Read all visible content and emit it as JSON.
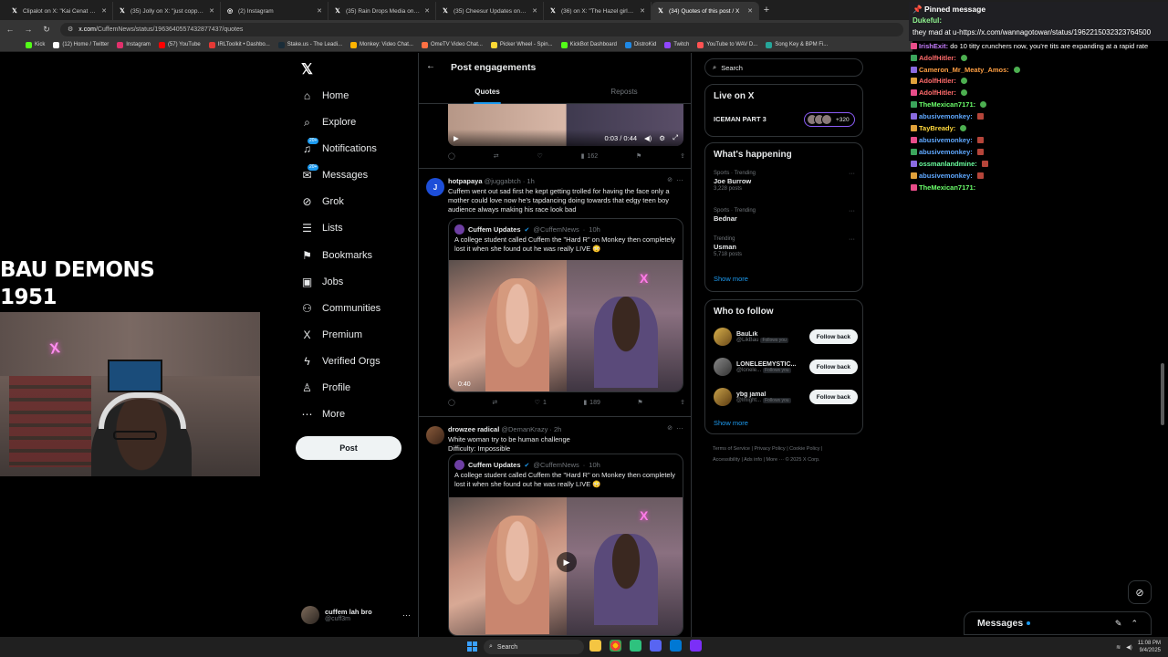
{
  "browser": {
    "tabs": [
      {
        "title": "Clipalot on X: \"Kai Cenat w...",
        "icon": "x-logo-icon",
        "active": false
      },
      {
        "title": "(35) Jolly on X: \"just copped a n...",
        "icon": "x-logo-icon",
        "active": false
      },
      {
        "title": "(2) Instagram",
        "icon": "instagram-icon",
        "active": false
      },
      {
        "title": "(35) Rain Drops Media on X: \"i...",
        "icon": "x-logo-icon",
        "active": false
      },
      {
        "title": "(35) Cheesur Updates on X: \"Ch...",
        "icon": "x-logo-icon",
        "active": false
      },
      {
        "title": "(36) on X: \"The Hazel girls bf p...",
        "icon": "x-logo-icon",
        "active": false
      },
      {
        "title": "(34) Quotes of this post / X",
        "icon": "x-logo-icon",
        "active": true
      }
    ],
    "url_domain": "x.com",
    "url_path": "/CuffemNews/status/1963640557432877437/quotes",
    "bookmarks": [
      {
        "label": "Kick",
        "color": "#53fc18"
      },
      {
        "label": "(12) Home / Twitter",
        "color": "#ffffff"
      },
      {
        "label": "Instagram",
        "color": "#e1306c"
      },
      {
        "label": "(57) YouTube",
        "color": "#ff0000"
      },
      {
        "label": "IRLToolkit • Dashbo...",
        "color": "#e53935"
      },
      {
        "label": "Stake.us - The Leadi...",
        "color": "#1a2c38"
      },
      {
        "label": "Monkey: Video Chat...",
        "color": "#ffb300"
      },
      {
        "label": "OmeTV Video Chat...",
        "color": "#ff7043"
      },
      {
        "label": "Picker Wheel - Spin...",
        "color": "#fdd835"
      },
      {
        "label": "KickBot Dashboard",
        "color": "#53fc18"
      },
      {
        "label": "DistroKid",
        "color": "#1e88e5"
      },
      {
        "label": "Twitch",
        "color": "#9146ff"
      },
      {
        "label": "YouTube to WAV D...",
        "color": "#ff5252"
      },
      {
        "label": "Song Key & BPM Fi...",
        "color": "#26a69a"
      }
    ]
  },
  "overlay": {
    "line1": "BAU DEMONS",
    "line2": "1951",
    "neon_sign": "X"
  },
  "x_nav": {
    "items": [
      {
        "label": "Home",
        "icon": "home-icon",
        "glyph": "⌂"
      },
      {
        "label": "Explore",
        "icon": "search-icon",
        "glyph": "⌕"
      },
      {
        "label": "Notifications",
        "icon": "bell-icon",
        "glyph": "♫",
        "badge": "20+"
      },
      {
        "label": "Messages",
        "icon": "envelope-icon",
        "glyph": "✉",
        "badge": "20+"
      },
      {
        "label": "Grok",
        "icon": "grok-icon",
        "glyph": "⊘"
      },
      {
        "label": "Lists",
        "icon": "list-icon",
        "glyph": "☰"
      },
      {
        "label": "Bookmarks",
        "icon": "bookmark-icon",
        "glyph": "⚑"
      },
      {
        "label": "Jobs",
        "icon": "briefcase-icon",
        "glyph": "▣"
      },
      {
        "label": "Communities",
        "icon": "people-icon",
        "glyph": "⚇"
      },
      {
        "label": "Premium",
        "icon": "x-logo-icon",
        "glyph": "X"
      },
      {
        "label": "Verified Orgs",
        "icon": "lightning-icon",
        "glyph": "ϟ"
      },
      {
        "label": "Profile",
        "icon": "person-icon",
        "glyph": "♙"
      },
      {
        "label": "More",
        "icon": "more-circle-icon",
        "glyph": "⋯"
      }
    ],
    "post_button": "Post",
    "account": {
      "name": "cuffem lah bro",
      "handle": "@cuff3m"
    }
  },
  "main": {
    "title": "Post engagements",
    "tabs": [
      {
        "label": "Quotes",
        "active": true
      },
      {
        "label": "Reposts",
        "active": false
      }
    ],
    "top_video": {
      "time": "0:03 / 0:44",
      "views": "162"
    },
    "tweet1": {
      "avatar_letter": "J",
      "name": "hotpapaya",
      "handle": "@juggabtch",
      "time": "1h",
      "text": "Cuffem went out sad first he kept getting trolled for having the face only a mother could love now he's tapdancing doing towards that edgy teen boy audience always making his race look bad",
      "quote_name": "Cuffem Updates",
      "quote_handle": "@CuffemNews",
      "quote_time": "10h",
      "quote_text": "A college student called Cuffem the \"Hard R\" on Monkey then completely lost it when she found out he was really LIVE 😳",
      "duration": "0:40",
      "likes": "1",
      "views": "189"
    },
    "tweet2": {
      "name": "drowzee radical",
      "handle": "@DemanKrazy",
      "time": "2h",
      "text_line1": "White woman try to be human challenge",
      "text_line2": "Difficulty: Impossible",
      "quote_name": "Cuffem Updates",
      "quote_handle": "@CuffemNews",
      "quote_time": "10h",
      "quote_text": "A college student called Cuffem the \"Hard R\" on Monkey then completely lost it when she found out he was really LIVE 😳"
    }
  },
  "right": {
    "search_placeholder": "Search",
    "live_heading": "Live on X",
    "live_title": "ICEMAN PART 3",
    "live_count": "+320",
    "happening_heading": "What's happening",
    "trends": [
      {
        "category": "Sports · Trending",
        "name": "Joe Burrow",
        "posts": "3,228 posts"
      },
      {
        "category": "Sports · Trending",
        "name": "Bednar",
        "posts": ""
      },
      {
        "category": "Trending",
        "name": "Usman",
        "posts": "5,718 posts"
      }
    ],
    "show_more": "Show more",
    "wtf_heading": "Who to follow",
    "who_to_follow": [
      {
        "name": "BauLik",
        "handle": "@LikBau",
        "follows_you": "Follows you",
        "button": "Follow back"
      },
      {
        "name": "LONELEEMYSTIC...",
        "handle": "@lonele...",
        "follows_you": "Follows you",
        "button": "Follow back"
      },
      {
        "name": "ybg jamal",
        "handle": "@lmight...",
        "follows_you": "Follows you",
        "button": "Follow back"
      }
    ],
    "footer_line1": "Terms of Service  |  Privacy Policy  |  Cookie Policy  |",
    "footer_line2": "Accessibility  |  Ads info  |  More ···  © 2025 X Corp."
  },
  "chat": {
    "pinned_header": "Pinned message",
    "pinned_user": "Dukeful:",
    "pinned_text": "they mad at u-https://x.com/wannagotowar/status/1962215032323764500",
    "lines": [
      {
        "user": "IrishExit:",
        "color": "#c77dff",
        "msg": "do 10 titty crunchers now, you're tits are expanding at a rapid rate",
        "emote": ""
      },
      {
        "user": "AdolfHitler:",
        "color": "#ff6b6b",
        "msg": "",
        "emote": "green"
      },
      {
        "user": "Cameron_Mr_Meaty_Amos:",
        "color": "#ff9f43",
        "msg": "",
        "emote": "green"
      },
      {
        "user": "AdolfHitler:",
        "color": "#ff6b6b",
        "msg": "",
        "emote": "green"
      },
      {
        "user": "AdolfHitler:",
        "color": "#ff6b6b",
        "msg": "",
        "emote": "green"
      },
      {
        "user": "TheMexican7171:",
        "color": "#6bff6b",
        "msg": "",
        "emote": "green"
      },
      {
        "user": "abusivemonkey:",
        "color": "#5fa8ff",
        "msg": "",
        "emote": "red"
      },
      {
        "user": "TayBready:",
        "color": "#ffd93d",
        "msg": "",
        "emote": "green"
      },
      {
        "user": "abusivemonkey:",
        "color": "#5fa8ff",
        "msg": "",
        "emote": "red"
      },
      {
        "user": "abusivemonkey:",
        "color": "#5fa8ff",
        "msg": "",
        "emote": "red"
      },
      {
        "user": "ossmanlandmine:",
        "color": "#6bff9f",
        "msg": "",
        "emote": "red"
      },
      {
        "user": "abusivemonkey:",
        "color": "#5fa8ff",
        "msg": "",
        "emote": "red"
      },
      {
        "user": "TheMexican7171:",
        "color": "#6bff6b",
        "msg": "",
        "emote": ""
      }
    ]
  },
  "messages_drawer": {
    "label": "Messages"
  },
  "taskbar": {
    "search": "Search",
    "time": "11:08 PM",
    "date": "9/4/2025"
  }
}
